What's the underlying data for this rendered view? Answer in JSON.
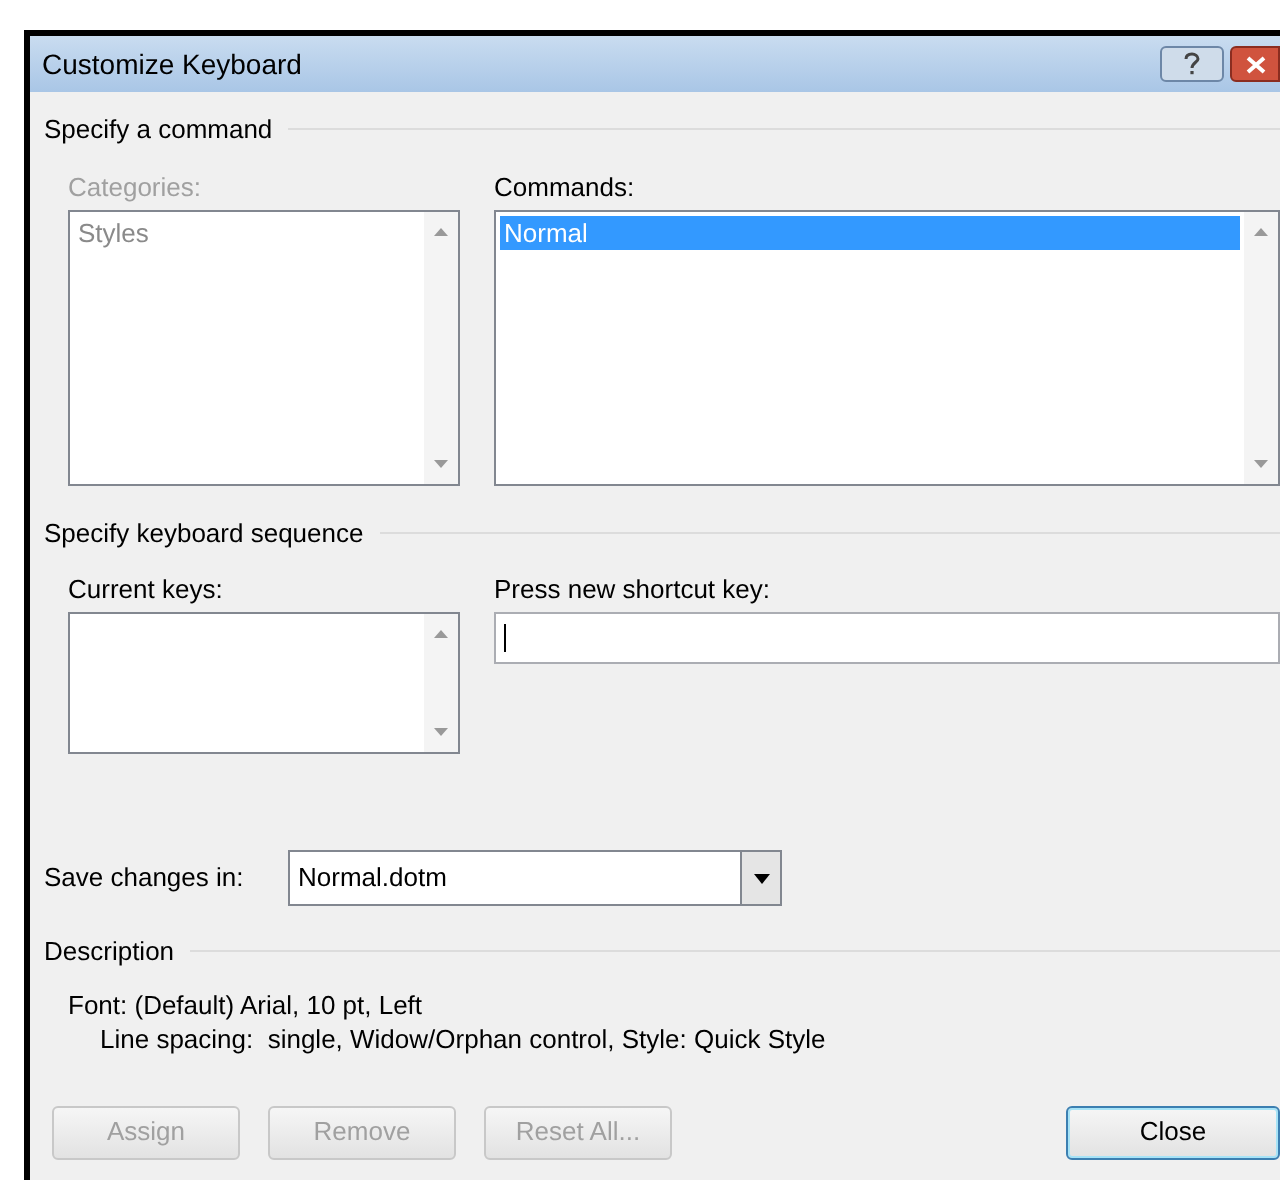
{
  "window": {
    "title": "Customize Keyboard"
  },
  "specify_command": {
    "title": "Specify a command",
    "categories": {
      "label": "Categories:",
      "disabled": true,
      "items": [
        {
          "text": "Styles",
          "selected": false
        }
      ]
    },
    "commands": {
      "label": "Commands:",
      "disabled": false,
      "items": [
        {
          "text": "Normal",
          "selected": true
        }
      ]
    }
  },
  "keyboard_sequence": {
    "title": "Specify keyboard sequence",
    "current_keys": {
      "label": "Current keys:"
    },
    "new_shortcut": {
      "label": "Press new shortcut key:"
    }
  },
  "save_changes": {
    "label": "Save changes in:",
    "value": "Normal.dotm"
  },
  "description": {
    "title": "Description",
    "lines": [
      "Font: (Default) Arial, 10 pt, Left",
      "Line spacing:  single, Widow/Orphan control, Style: Quick Style"
    ]
  },
  "buttons": [
    {
      "label": "Assign",
      "disabled": true,
      "default": false
    },
    {
      "label": "Remove",
      "disabled": true,
      "default": false
    },
    {
      "label": "Reset All...",
      "disabled": true,
      "default": false
    },
    {
      "label": "Close",
      "disabled": false,
      "default": true
    }
  ]
}
